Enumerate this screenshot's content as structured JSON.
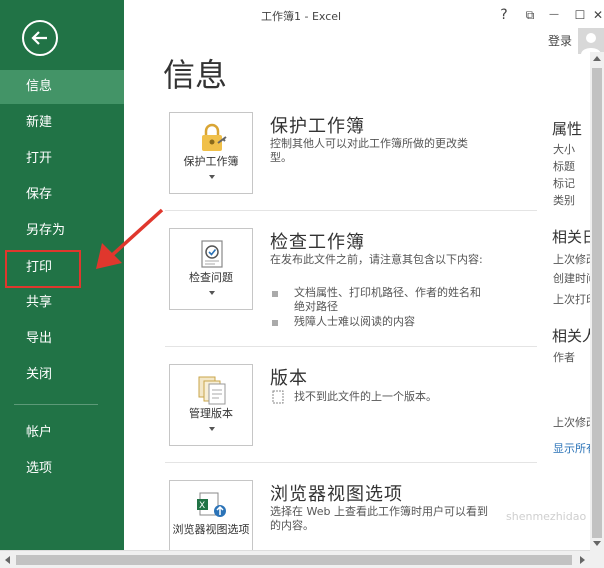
{
  "window": {
    "title": "工作簿1 - Excel",
    "help": "?",
    "restore": "⧉",
    "minimize": "—",
    "maximize": "☐",
    "close": "✕",
    "login": "登录"
  },
  "sidebar": {
    "back_icon": "back-arrow-icon",
    "items": [
      {
        "label": "信息",
        "active": true
      },
      {
        "label": "新建"
      },
      {
        "label": "打开"
      },
      {
        "label": "保存"
      },
      {
        "label": "另存为"
      },
      {
        "label": "打印"
      },
      {
        "label": "共享"
      },
      {
        "label": "导出"
      },
      {
        "label": "关闭"
      },
      {
        "label": "帐户"
      },
      {
        "label": "选项"
      }
    ]
  },
  "page": {
    "title": "信息"
  },
  "sections": {
    "protect": {
      "button_label": "保护工作簿",
      "title": "保护工作簿",
      "desc": "控制其他人可以对此工作簿所做的更改类型。"
    },
    "inspect": {
      "button_label": "检查问题",
      "title": "检查工作簿",
      "desc": "在发布此文件之前，请注意其包含以下内容:",
      "bullets": [
        "文档属性、打印机路径、作者的姓名和绝对路径",
        "残障人士难以阅读的内容"
      ]
    },
    "versions": {
      "button_label": "管理版本",
      "title": "版本",
      "desc": "找不到此文件的上一个版本。"
    },
    "browser": {
      "button_label": "浏览器视图选项",
      "title": "浏览器视图选项",
      "desc": "选择在 Web 上查看此工作簿时用户可以看到的内容。"
    }
  },
  "properties": {
    "heading": "属性",
    "labels": [
      "大小",
      "标题",
      "标记",
      "类别"
    ],
    "related_dates_heading": "相关日期",
    "dates": [
      "上次修改时间",
      "创建时间",
      "上次打印时间"
    ],
    "related_people_heading": "相关人员",
    "people_label": "作者",
    "last_modified_by": "上次修改者",
    "show_all": "显示所有属性"
  },
  "watermark": "shenmezhidao"
}
